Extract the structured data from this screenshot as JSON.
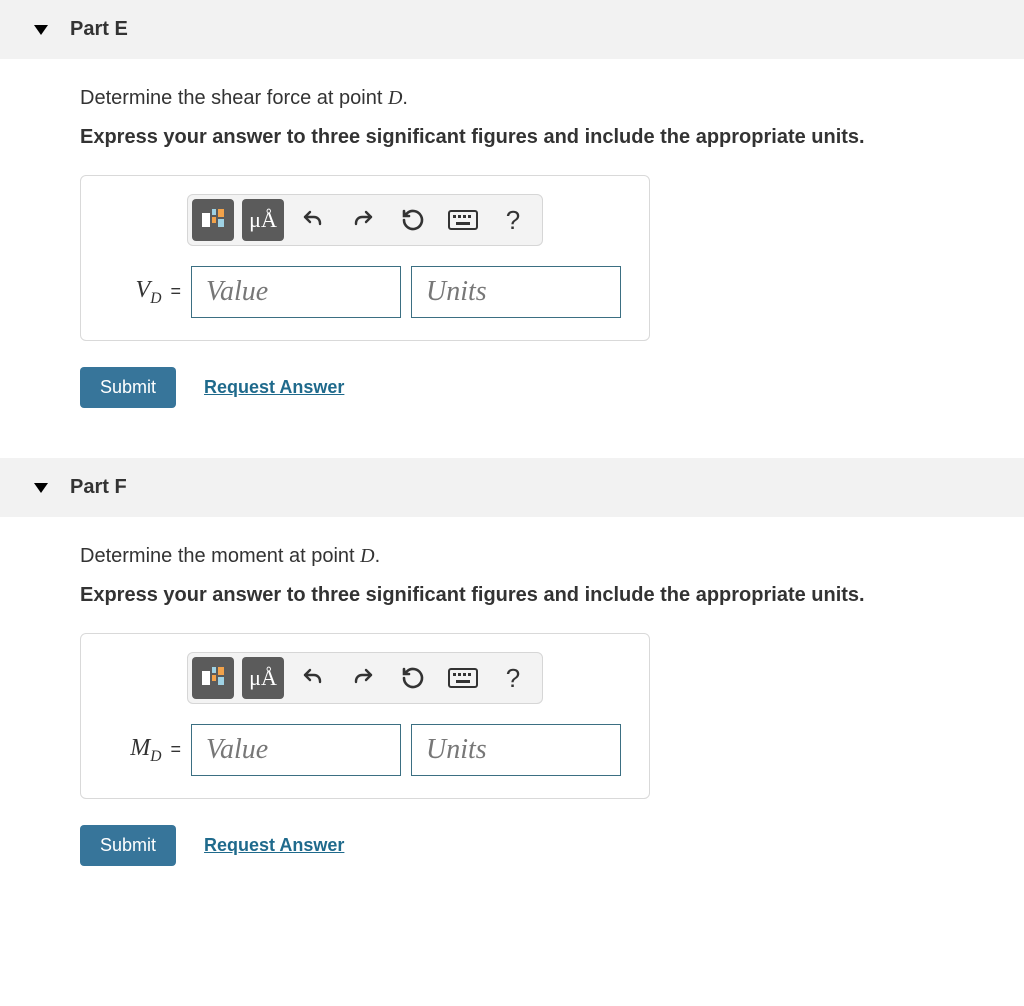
{
  "parts": [
    {
      "id": "E",
      "header": "Part E",
      "prompt_pre": "Determine the shear force at point ",
      "prompt_var": "D",
      "prompt_post": ".",
      "instruction": "Express your answer to three significant figures and include the appropriate units.",
      "var_main": "V",
      "var_sub": "D",
      "eq": " =",
      "value_placeholder": "Value",
      "units_placeholder": "Units",
      "toolbar": {
        "units_btn": "μÅ",
        "help": "?"
      },
      "submit": "Submit",
      "request": "Request Answer"
    },
    {
      "id": "F",
      "header": "Part F",
      "prompt_pre": "Determine the moment at point ",
      "prompt_var": "D",
      "prompt_post": ".",
      "instruction": "Express your answer to three significant figures and include the appropriate units.",
      "var_main": "M",
      "var_sub": "D",
      "eq": " =",
      "value_placeholder": "Value",
      "units_placeholder": "Units",
      "toolbar": {
        "units_btn": "μÅ",
        "help": "?"
      },
      "submit": "Submit",
      "request": "Request Answer"
    }
  ]
}
